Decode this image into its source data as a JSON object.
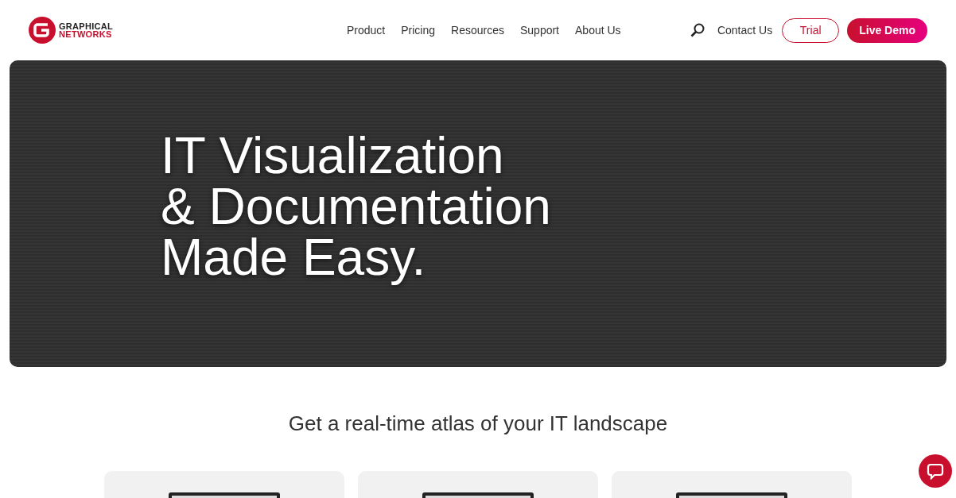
{
  "logo": {
    "line_1": "GRAPHICAL",
    "line_2": "NETWORKS"
  },
  "nav": {
    "items": [
      "Product",
      "Pricing",
      "Resources",
      "Support",
      "About Us"
    ]
  },
  "header_actions": {
    "contact": "Contact Us",
    "trial": "Trial",
    "demo": "Live Demo"
  },
  "hero": {
    "title_lines": [
      "IT Visualization",
      "& Documentation",
      "Made Easy."
    ]
  },
  "section": {
    "heading": "Get a real-time atlas of your IT landscape"
  },
  "cards": [
    {
      "kind": "laptop"
    },
    {
      "kind": "laptop"
    },
    {
      "kind": "laptop"
    }
  ]
}
